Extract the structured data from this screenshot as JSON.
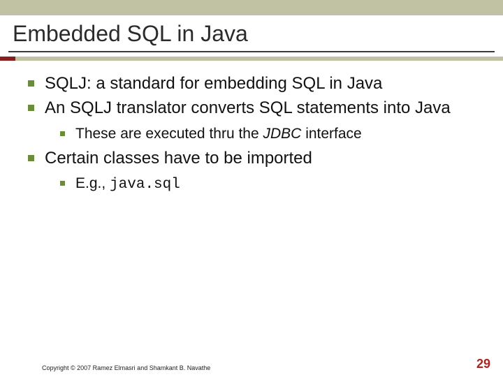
{
  "title": "Embedded SQL in Java",
  "bullets": {
    "b1": "SQLJ: a standard for embedding SQL in Java",
    "b2": "An SQLJ translator converts SQL statements into Java",
    "b2_sub1_lead": "These are executed thru the ",
    "b2_sub1_em": "JDBC ",
    "b2_sub1_tail": "interface",
    "b3": "Certain classes have to be imported",
    "b3_sub1_lead": "E.g., ",
    "b3_sub1_code": "java.sql"
  },
  "footer": {
    "copyright": "Copyright © 2007 Ramez Elmasri and Shamkant B. Navathe",
    "page": "29"
  }
}
